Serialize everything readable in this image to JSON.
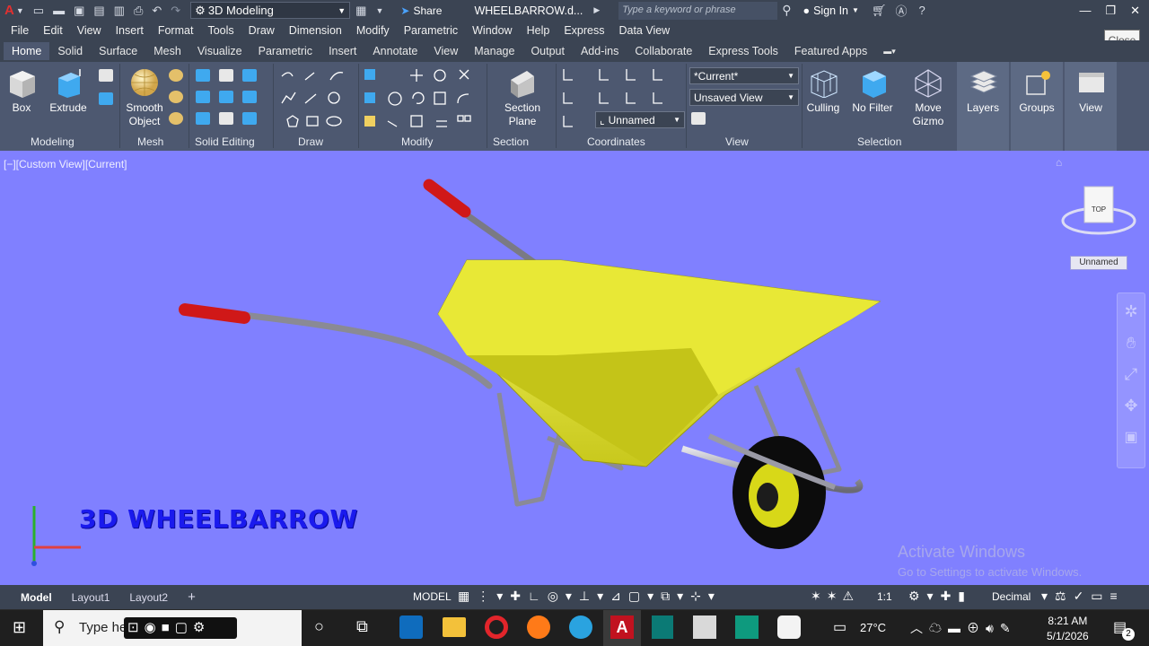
{
  "titlebar": {
    "workspace": "3D Modeling",
    "share_label": "Share",
    "document_title": "WHEELBARROW.d...",
    "search_placeholder": "Type a keyword or phrase",
    "signin_label": "Sign In"
  },
  "menubar": [
    "File",
    "Edit",
    "View",
    "Insert",
    "Format",
    "Tools",
    "Draw",
    "Dimension",
    "Modify",
    "Parametric",
    "Window",
    "Help",
    "Express",
    "Data View"
  ],
  "ribbon_tabs": [
    "Home",
    "Solid",
    "Surface",
    "Mesh",
    "Visualize",
    "Parametric",
    "Insert",
    "Annotate",
    "View",
    "Manage",
    "Output",
    "Add-ins",
    "Collaborate",
    "Express Tools",
    "Featured Apps"
  ],
  "ribbon": {
    "box_label": "Box",
    "extrude_label": "Extrude",
    "smooth_label_1": "Smooth",
    "smooth_label_2": "Object",
    "section_plane_1": "Section",
    "section_plane_2": "Plane",
    "culling_label": "Culling",
    "nofilter_label": "No Filter",
    "move_gizmo_1": "Move",
    "move_gizmo_2": "Gizmo",
    "layers_label": "Layers",
    "groups_label": "Groups",
    "view_label": "View",
    "visual_style_value": "*Current*",
    "named_view_value": "Unsaved View",
    "ucs_value": "Unnamed",
    "panels": {
      "modeling": "Modeling",
      "mesh": "Mesh",
      "solid_editing": "Solid Editing",
      "draw": "Draw",
      "modify": "Modify",
      "section": "Section",
      "coordinates": "Coordinates",
      "view": "View",
      "selection": "Selection"
    }
  },
  "viewport": {
    "view_label": "[−][Custom View][Current]",
    "title_text": "3D WHEELBARROW",
    "viewcube_face": "TOP",
    "ucs_dropdown": "Unnamed",
    "watermark_1": "Activate Windows",
    "watermark_2": "Go to Settings to activate Windows.",
    "background_color": "#8080ff",
    "tub_color": "#e8e836",
    "handle_color": "#d01818"
  },
  "close_tooltip": "Close",
  "layout_tabs": [
    "Model",
    "Layout1",
    "Layout2"
  ],
  "statusbar": {
    "model_label": "MODEL",
    "scale": "1:1",
    "units": "Decimal"
  },
  "taskbar": {
    "search_placeholder": "Type he",
    "temperature": "27°C",
    "time": "8:21 AM",
    "date": "5/1/2026",
    "notification_count": "2"
  }
}
